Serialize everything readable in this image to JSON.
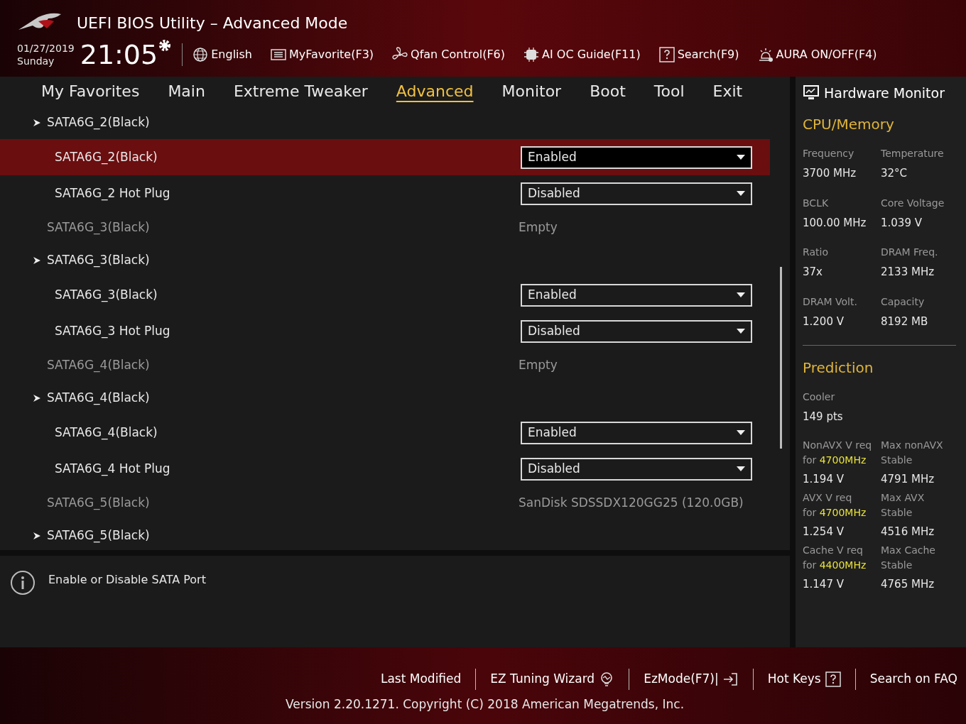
{
  "header": {
    "title": "UEFI BIOS Utility – Advanced Mode",
    "date": "01/27/2019",
    "day": "Sunday",
    "time": "21:05",
    "tools": [
      {
        "kind": "globe",
        "label": "English"
      },
      {
        "kind": "list",
        "label": "MyFavorite(F3)"
      },
      {
        "kind": "fan",
        "label": "Qfan Control(F6)"
      },
      {
        "kind": "chip",
        "label": "AI OC Guide(F11)"
      },
      {
        "kind": "help",
        "label": "Search(F9)"
      },
      {
        "kind": "aura",
        "label": "AURA ON/OFF(F4)"
      }
    ]
  },
  "tabs": [
    {
      "label": "My Favorites",
      "selected": false
    },
    {
      "label": "Main",
      "selected": false
    },
    {
      "label": "Extreme Tweaker",
      "selected": false
    },
    {
      "label": "Advanced",
      "selected": true
    },
    {
      "label": "Monitor",
      "selected": false
    },
    {
      "label": "Boot",
      "selected": false
    },
    {
      "label": "Tool",
      "selected": false
    },
    {
      "label": "Exit",
      "selected": false
    }
  ],
  "rows": [
    {
      "kind": "group",
      "label": "SATA6G_2(Black)"
    },
    {
      "kind": "setting",
      "label": "SATA6G_2(Black)",
      "value": "Enabled",
      "selected": true
    },
    {
      "kind": "setting",
      "label": "SATA6G_2 Hot Plug",
      "value": "Disabled",
      "selected": false
    },
    {
      "kind": "info",
      "label": "SATA6G_3(Black)",
      "value": "Empty"
    },
    {
      "kind": "group",
      "label": "SATA6G_3(Black)"
    },
    {
      "kind": "setting",
      "label": "SATA6G_3(Black)",
      "value": "Enabled",
      "selected": false
    },
    {
      "kind": "setting",
      "label": "SATA6G_3 Hot Plug",
      "value": "Disabled",
      "selected": false
    },
    {
      "kind": "info",
      "label": "SATA6G_4(Black)",
      "value": "Empty"
    },
    {
      "kind": "group",
      "label": "SATA6G_4(Black)"
    },
    {
      "kind": "setting",
      "label": "SATA6G_4(Black)",
      "value": "Enabled",
      "selected": false
    },
    {
      "kind": "setting",
      "label": "SATA6G_4 Hot Plug",
      "value": "Disabled",
      "selected": false
    },
    {
      "kind": "info",
      "label": "SATA6G_5(Black)",
      "value": "SanDisk SDSSDX120GG25 (120.0GB)"
    },
    {
      "kind": "group",
      "label": "SATA6G_5(Black)"
    }
  ],
  "help": "Enable or Disable SATA Port",
  "monitor": {
    "title": "Hardware Monitor",
    "cpu_title": "CPU/Memory",
    "cpu": [
      {
        "label": "Frequency",
        "value": "3700 MHz"
      },
      {
        "label": "Temperature",
        "value": "32°C"
      },
      {
        "label": "BCLK",
        "value": "100.00 MHz"
      },
      {
        "label": "Core Voltage",
        "value": "1.039 V"
      },
      {
        "label": "Ratio",
        "value": "37x"
      },
      {
        "label": "DRAM Freq.",
        "value": "2133 MHz"
      },
      {
        "label": "DRAM Volt.",
        "value": "1.200 V"
      },
      {
        "label": "Capacity",
        "value": "8192 MB"
      }
    ],
    "prediction_title": "Prediction",
    "cooler_label": "Cooler",
    "cooler_value": "149 pts",
    "prediction": [
      {
        "label": "NonAVX V req",
        "sub": "for **4700MHz**",
        "value": "1.194 V"
      },
      {
        "label": "Max nonAVX",
        "sub": "Stable",
        "value": "4791 MHz"
      },
      {
        "label": "AVX V req",
        "sub": "for **4700MHz**",
        "value": "1.254 V"
      },
      {
        "label": "Max AVX",
        "sub": "Stable",
        "value": "4516 MHz"
      },
      {
        "label": "Cache V req",
        "sub": "for **4400MHz**",
        "value": "1.147 V"
      },
      {
        "label": "Max Cache",
        "sub": "Stable",
        "value": "4765 MHz"
      }
    ]
  },
  "footer": {
    "links": [
      {
        "kind": "plain",
        "label": "Last Modified"
      },
      {
        "kind": "bulb",
        "label": "EZ Tuning Wizard"
      },
      {
        "kind": "exit",
        "label": "EzMode(F7)|"
      },
      {
        "kind": "help",
        "label": "Hot Keys"
      },
      {
        "kind": "plain",
        "label": "Search on FAQ"
      }
    ],
    "version": "Version 2.20.1271. Copyright (C) 2018 American Megatrends, Inc."
  }
}
